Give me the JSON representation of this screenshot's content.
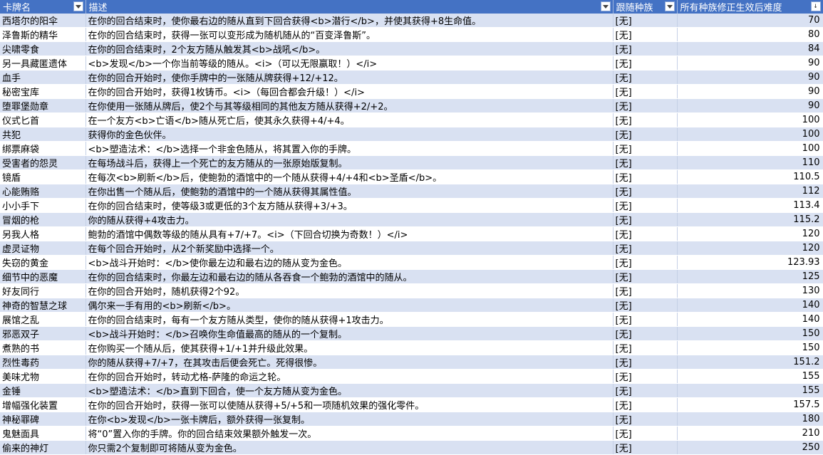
{
  "columns": [
    {
      "label": "卡牌名",
      "filter": "dropdown"
    },
    {
      "label": "描述",
      "filter": "dropdown"
    },
    {
      "label": "跟随种族",
      "filter": "dropdown"
    },
    {
      "label": "所有种族修正生效后难度",
      "filter": "sort-ascending"
    }
  ],
  "rows": [
    {
      "name": "西塔尔的阳伞",
      "desc": "在你的回合结束时，使你最右边的随从直到下回合获得<b>潜行</b>，并使其获得+8生命值。",
      "tribe": "[无]",
      "diff": "70"
    },
    {
      "name": "泽鲁斯的精华",
      "desc": "在你的回合结束时，获得一张可以变形成为随机随从的“百变泽鲁斯”。",
      "tribe": "[无]",
      "diff": "80"
    },
    {
      "name": "尖啸零食",
      "desc": "在你的回合结束时，2个友方随从触发其<b>战吼</b>。",
      "tribe": "[无]",
      "diff": "84"
    },
    {
      "name": "另一具藏匿遗体",
      "desc": "<b>发现</b>一个你当前等级的随从。<i>（可以无限赢取！）</i>",
      "tribe": "[无]",
      "diff": "90"
    },
    {
      "name": "血手",
      "desc": "在你的回合开始时，使你手牌中的一张随从牌获得+12/+12。",
      "tribe": "[无]",
      "diff": "90"
    },
    {
      "name": "秘密宝库",
      "desc": "在你的回合开始时，获得1枚铸币。<i>（每回合都会升级！）</i>",
      "tribe": "[无]",
      "diff": "90"
    },
    {
      "name": "堕罪堡勋章",
      "desc": "在你使用一张随从牌后，使2个与其等级相同的其他友方随从获得+2/+2。",
      "tribe": "[无]",
      "diff": "90"
    },
    {
      "name": "仪式匕首",
      "desc": "在一个友方<b>亡语</b>随从死亡后，使其永久获得+4/+4。",
      "tribe": "[无]",
      "diff": "100"
    },
    {
      "name": "共犯",
      "desc": "获得你的金色伙伴。",
      "tribe": "[无]",
      "diff": "100"
    },
    {
      "name": "绑票麻袋",
      "desc": "<b>塑造法术：</b>选择一个非金色随从，将其置入你的手牌。",
      "tribe": "[无]",
      "diff": "100"
    },
    {
      "name": "受害者的怨灵",
      "desc": " 在每场战斗后，获得上一个死亡的友方随从的一张原始版复制。",
      "tribe": "[无]",
      "diff": "110"
    },
    {
      "name": "镜盾",
      "desc": "在每次<b>刷新</b>后，使鲍勃的酒馆中的一个随从获得+4/+4和<b>圣盾</b>。",
      "tribe": "[无]",
      "diff": "110.5"
    },
    {
      "name": "心能贿赂",
      "desc": "在你出售一个随从后，使鲍勃的酒馆中的一个随从获得其属性值。",
      "tribe": "[无]",
      "diff": "112"
    },
    {
      "name": "小小手下",
      "desc": "在你的回合结束时，使等级3或更低的3个友方随从获得+3/+3。",
      "tribe": "[无]",
      "diff": "113.4"
    },
    {
      "name": "冒烟的枪",
      "desc": "你的随从获得+4攻击力。",
      "tribe": "[无]",
      "diff": "115.2"
    },
    {
      "name": "另我人格",
      "desc": "鲍勃的酒馆中偶数等级的随从具有+7/+7。<i>（下回合切换为奇数！）</i>",
      "tribe": "[无]",
      "diff": "120"
    },
    {
      "name": "虚灵证物",
      "desc": "在每个回合开始时，从2个新奖励中选择一个。",
      "tribe": "[无]",
      "diff": "120"
    },
    {
      "name": "失窃的黄金",
      "desc": "<b>战斗开始时：</b>使你最左边和最右边的随从变为金色。",
      "tribe": "[无]",
      "diff": "123.93"
    },
    {
      "name": "细节中的恶魔",
      "desc": "在你的回合结束时，你最左边和最右边的随从各吞食一个鲍勃的酒馆中的随从。",
      "tribe": "[无]",
      "diff": "125"
    },
    {
      "name": "好友同行",
      "desc": "在你的回合开始时，随机获得2个92。",
      "tribe": "[无]",
      "diff": "130"
    },
    {
      "name": "神奇的智慧之球",
      "desc": "偶尔来一手有用的<b>刷新</b>。",
      "tribe": "[无]",
      "diff": "140"
    },
    {
      "name": "展馆之乱",
      "desc": "在你的回合结束时，每有一个友方随从类型，使你的随从获得+1攻击力。",
      "tribe": "[无]",
      "diff": "140"
    },
    {
      "name": "邪恶双子",
      "desc": "<b>战斗开始时：</b>召唤你生命值最高的随从的一个复制。",
      "tribe": "[无]",
      "diff": "150"
    },
    {
      "name": "煮熟的书",
      "desc": "在你购买一个随从后，使其获得+1/+1并升级此效果。",
      "tribe": "[无]",
      "diff": "150"
    },
    {
      "name": "烈性毒药",
      "desc": "你的随从获得+7/+7，在其攻击后便会死亡。死得很惨。",
      "tribe": "[无]",
      "diff": "151.2"
    },
    {
      "name": "美味尤物",
      "desc": "在你的回合开始时，转动尤格-萨隆的命运之轮。",
      "tribe": "[无]",
      "diff": "155"
    },
    {
      "name": "金锤",
      "desc": "<b>塑造法术：</b>直到下回合，使一个友方随从变为金色。",
      "tribe": "[无]",
      "diff": "155"
    },
    {
      "name": "增幅强化装置",
      "desc": "在你的回合开始时，获得一张可以使随从获得+5/+5和一项随机效果的强化零件。",
      "tribe": "[无]",
      "diff": "157.5"
    },
    {
      "name": "神秘罪碑",
      "desc": "在你<b>发现</b>一张卡牌后，额外获得一张复制。",
      "tribe": "[无]",
      "diff": "180"
    },
    {
      "name": "鬼魅面具",
      "desc": "将“0”置入你的手牌。你的回合结束效果额外触发一次。",
      "tribe": "[无]",
      "diff": "210"
    },
    {
      "name": "偷来的神灯",
      "desc": "你只需2个复制即可将随从变为金色。",
      "tribe": "[无]",
      "diff": "250"
    }
  ]
}
